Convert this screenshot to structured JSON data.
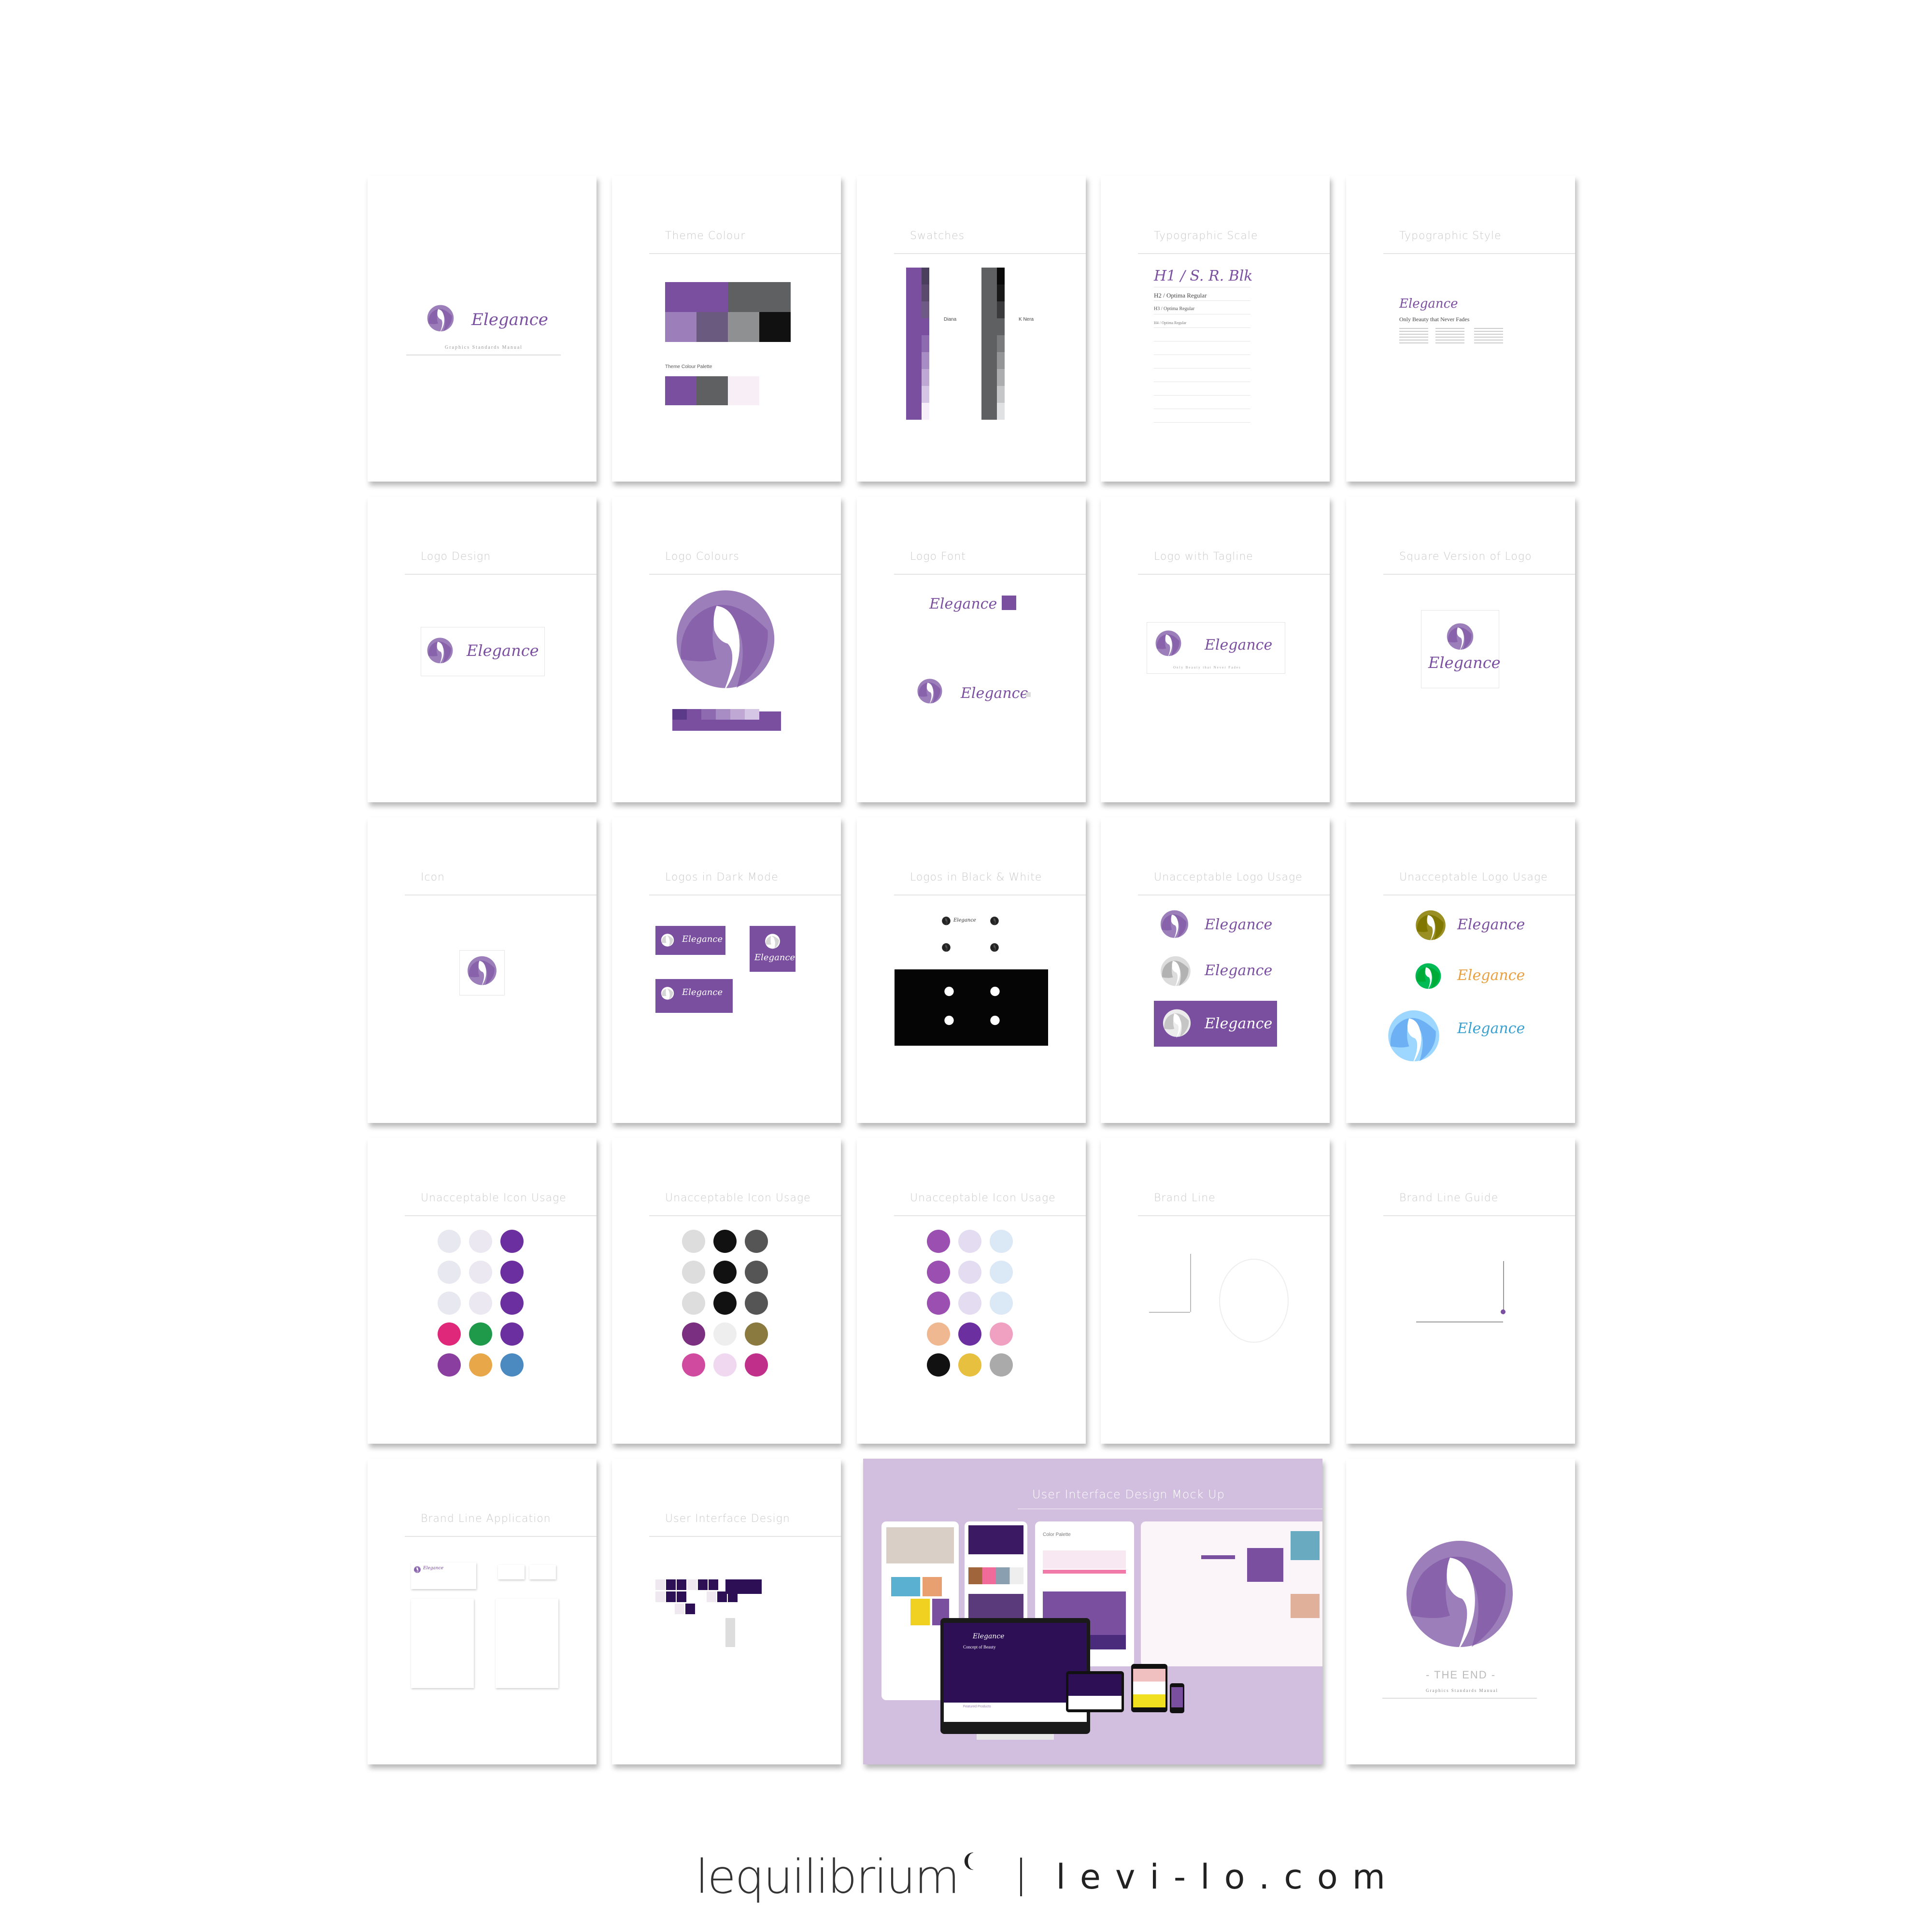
{
  "colors": {
    "purple": "#7b4fa0",
    "light_purple": "#9c7fba",
    "pale_purple": "#c9b3dc",
    "dark_grey": "#5f6061",
    "grey": "#8e9092",
    "black": "#111111",
    "pale_pink": "#f8eef6",
    "mock_bg": "#d2bfdf"
  },
  "brand": {
    "wordmark": "Elegance",
    "tagline": "Only Beauty that Never Fades",
    "manual": "Graphics Standards Manual"
  },
  "pages": [
    {
      "kind": "cover",
      "title": ""
    },
    {
      "kind": "theme",
      "title": "Theme Colour",
      "palette_label": "Theme Colour Palette"
    },
    {
      "kind": "swatches",
      "title": "Swatches",
      "left_name": "Diana",
      "right_name": "K Nera"
    },
    {
      "kind": "typescale",
      "title": "Typographic Scale",
      "h1": "H1 / S. R. Blk",
      "h2": "H2 / Optima Regular",
      "h3": "H3 / Optima Regular",
      "h4": "H4 / Optima Regular"
    },
    {
      "kind": "typestyle",
      "title": "Typographic Style"
    },
    {
      "kind": "logo-box",
      "title": "Logo Design"
    },
    {
      "kind": "logo-colours",
      "title": "Logo Colours"
    },
    {
      "kind": "logo-font",
      "title": "Logo Font"
    },
    {
      "kind": "logo-tagline",
      "title": "Logo with Tagline"
    },
    {
      "kind": "logo-square",
      "title": "Square Version of Logo"
    },
    {
      "kind": "icon",
      "title": "Icon"
    },
    {
      "kind": "dark",
      "title": "Logos in Dark Mode"
    },
    {
      "kind": "bw",
      "title": "Logos in Black & White"
    },
    {
      "kind": "bad-logo",
      "title": "Unacceptable Logo Usage"
    },
    {
      "kind": "bad-logo2",
      "title": "Unacceptable Logo Usage"
    },
    {
      "kind": "bad-icon",
      "title": "Unacceptable Icon Usage",
      "icons": [
        "#e8e8f0",
        "#ece8f2",
        "#6b2fa0",
        "#e8e8f0",
        "#ece8f2",
        "#6b2fa0",
        "#e8e8f0",
        "#ece8f2",
        "#6b2fa0",
        "#e0287a",
        "#1e9a4a",
        "#6b2fa0",
        "#8a3fa0",
        "#e8a84a",
        "#4a8ac0"
      ]
    },
    {
      "kind": "bad-icon",
      "title": "Unacceptable Icon Usage",
      "icons": [
        "#dddddd",
        "#111111",
        "#555555",
        "#dddddd",
        "#111111",
        "#555555",
        "#dddddd",
        "#111111",
        "#555555",
        "#7b2f80",
        "#eeeeee",
        "#8a7a40",
        "#d04aa0",
        "#f0d8f0",
        "#c0308a"
      ]
    },
    {
      "kind": "bad-icon",
      "title": "Unacceptable Icon Usage",
      "icons": [
        "#9b4fb0",
        "#e4dcf0",
        "#dbe8f6",
        "#9b4fb0",
        "#e4dcf0",
        "#dbe8f6",
        "#9b4fb0",
        "#e4dcf0",
        "#dbe8f6",
        "#f0b890",
        "#6b2fa0",
        "#f0a0c0",
        "#111111",
        "#e8c040",
        "#aaaaaa"
      ]
    },
    {
      "kind": "brandline",
      "title": "Brand Line"
    },
    {
      "kind": "brandline-guide",
      "title": "Brand Line Guide"
    },
    {
      "kind": "application",
      "title": "Brand Line Application"
    },
    {
      "kind": "ui",
      "title": "User Interface Design"
    },
    {
      "kind": "end",
      "title": "",
      "end_text": "- THE END -"
    }
  ],
  "mockup": {
    "title": "User Interface Design Mock Up",
    "hero": "Concept of Beauty",
    "featured": "Featured Products",
    "palette": "Color Palette"
  },
  "footer": {
    "brand": "lequilibrium",
    "site": "levi-lo.com"
  }
}
